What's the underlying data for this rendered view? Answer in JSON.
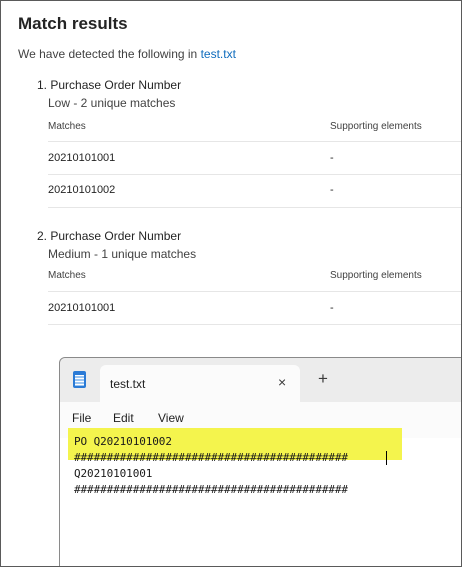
{
  "title": "Match results",
  "intro": {
    "text": "We have detected the following in ",
    "file_link": "test.txt"
  },
  "sections": [
    {
      "number": "1.",
      "heading": "Purchase Order Number",
      "subheading": "Low - 2 unique matches",
      "columns": [
        "Matches",
        "Supporting elements"
      ],
      "rows": [
        {
          "match": "20210101001",
          "supporting": "-"
        },
        {
          "match": "20210101002",
          "supporting": "-"
        }
      ]
    },
    {
      "number": "2.",
      "heading": "Purchase Order Number",
      "subheading": "Medium - 1 unique matches",
      "columns": [
        "Matches",
        "Supporting elements"
      ],
      "rows": [
        {
          "match": "20210101001",
          "supporting": "-"
        }
      ]
    }
  ],
  "notepad": {
    "tab_title": "test.txt",
    "close_icon": "×",
    "new_tab_icon": "+",
    "menu": [
      "File",
      "Edit",
      "View"
    ],
    "lines": [
      "PO Q20210101002",
      "##########################################",
      "Q20210101001",
      "##########################################"
    ],
    "highlight_color": "#f4f44d"
  }
}
